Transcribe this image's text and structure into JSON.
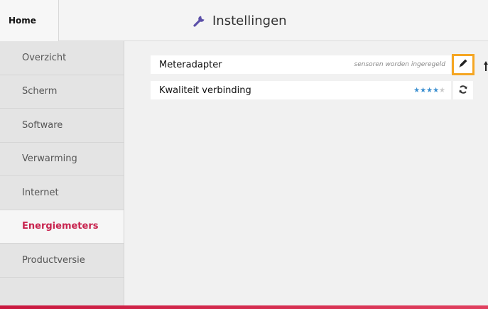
{
  "header": {
    "home_label": "Home",
    "title": "Instellingen",
    "title_icon": "wrench-icon"
  },
  "sidebar": {
    "items": [
      {
        "label": "Overzicht"
      },
      {
        "label": "Scherm"
      },
      {
        "label": "Software"
      },
      {
        "label": "Verwarming"
      },
      {
        "label": "Internet"
      },
      {
        "label": "Energiemeters",
        "active": true
      },
      {
        "label": "Productversie"
      }
    ]
  },
  "content": {
    "rows": [
      {
        "label": "Meteradapter",
        "status": "sensoren worden ingeregeld",
        "action_icon": "pencil-icon"
      },
      {
        "label": "Kwaliteit verbinding",
        "stars_filled": "★★★★",
        "stars_empty": "★",
        "rating": 4,
        "rating_max": 5,
        "action_icon": "refresh-icon"
      }
    ]
  },
  "colors": {
    "accent": "#c8244f",
    "highlight": "#f5a623",
    "star": "#3b8fd0"
  }
}
